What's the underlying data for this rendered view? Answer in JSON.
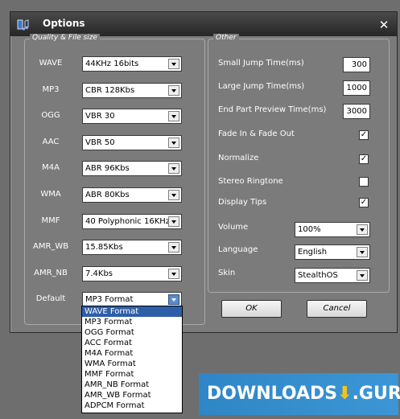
{
  "window": {
    "title": "Options",
    "close_symbol": "✕"
  },
  "quality": {
    "title": "Quality & File size",
    "rows": [
      {
        "label": "WAVE",
        "value": "44KHz 16bits"
      },
      {
        "label": "MP3",
        "value": "CBR 128Kbs"
      },
      {
        "label": "OGG",
        "value": "VBR 30"
      },
      {
        "label": "AAC",
        "value": "VBR 50"
      },
      {
        "label": "M4A",
        "value": "ABR 96Kbs"
      },
      {
        "label": "WMA",
        "value": "ABR 80Kbs"
      },
      {
        "label": "MMF",
        "value": "40 Polyphonic 16KHz"
      },
      {
        "label": "AMR_WB",
        "value": "15.85Kbs"
      },
      {
        "label": "AMR_NB",
        "value": "7.4Kbs"
      },
      {
        "label": "Default",
        "value": "MP3 Format"
      }
    ]
  },
  "other": {
    "title": "Other",
    "small_jump": {
      "label": "Small Jump Time(ms)",
      "value": "300"
    },
    "large_jump": {
      "label": "Large Jump Time(ms)",
      "value": "1000"
    },
    "end_preview": {
      "label": "End Part Preview Time(ms)",
      "value": "3000"
    },
    "fade": {
      "label": "Fade In & Fade Out",
      "checked": "✓"
    },
    "normalize": {
      "label": "Normalize",
      "checked": "✓"
    },
    "stereo": {
      "label": "Stereo Ringtone",
      "checked": ""
    },
    "tips": {
      "label": "Display Tips",
      "checked": "✓"
    },
    "volume": {
      "label": "Volume",
      "value": "100%"
    },
    "language": {
      "label": "Language",
      "value": "English"
    },
    "skin": {
      "label": "Skin",
      "value": "StealthOS"
    }
  },
  "buttons": {
    "ok": "OK",
    "cancel": "Cancel"
  },
  "dropdown": {
    "options": [
      "WAVE Format",
      "MP3 Format",
      "OGG Format",
      "ACC Format",
      "M4A Format",
      "WMA Format",
      "MMF Format",
      "AMR_NB Format",
      "AMR_WB Format",
      "ADPCM Format"
    ],
    "selected_index": 0
  },
  "watermark": {
    "text_left": "DOWNLOADS",
    "text_right": ".GURU",
    "icon": "download-arrow-icon"
  },
  "colors": {
    "dialog_bg": "#7b7b7b",
    "desktop_bg": "#6e6e6e",
    "selection": "#2f5ea8",
    "watermark": "#3c96d6"
  }
}
